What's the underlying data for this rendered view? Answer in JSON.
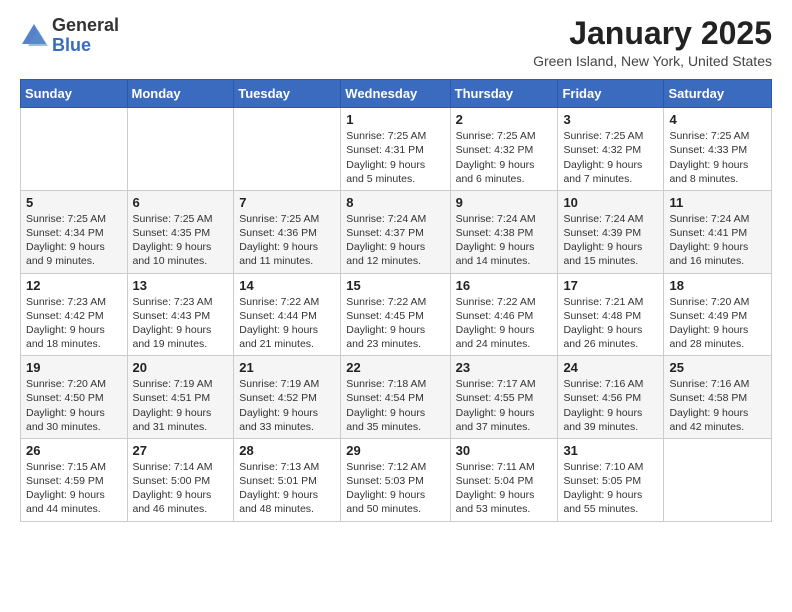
{
  "header": {
    "logo_general": "General",
    "logo_blue": "Blue",
    "month_title": "January 2025",
    "location": "Green Island, New York, United States"
  },
  "weekdays": [
    "Sunday",
    "Monday",
    "Tuesday",
    "Wednesday",
    "Thursday",
    "Friday",
    "Saturday"
  ],
  "weeks": [
    [
      {
        "day": "",
        "lines": []
      },
      {
        "day": "",
        "lines": []
      },
      {
        "day": "",
        "lines": []
      },
      {
        "day": "1",
        "lines": [
          "Sunrise: 7:25 AM",
          "Sunset: 4:31 PM",
          "Daylight: 9 hours",
          "and 5 minutes."
        ]
      },
      {
        "day": "2",
        "lines": [
          "Sunrise: 7:25 AM",
          "Sunset: 4:32 PM",
          "Daylight: 9 hours",
          "and 6 minutes."
        ]
      },
      {
        "day": "3",
        "lines": [
          "Sunrise: 7:25 AM",
          "Sunset: 4:32 PM",
          "Daylight: 9 hours",
          "and 7 minutes."
        ]
      },
      {
        "day": "4",
        "lines": [
          "Sunrise: 7:25 AM",
          "Sunset: 4:33 PM",
          "Daylight: 9 hours",
          "and 8 minutes."
        ]
      }
    ],
    [
      {
        "day": "5",
        "lines": [
          "Sunrise: 7:25 AM",
          "Sunset: 4:34 PM",
          "Daylight: 9 hours",
          "and 9 minutes."
        ]
      },
      {
        "day": "6",
        "lines": [
          "Sunrise: 7:25 AM",
          "Sunset: 4:35 PM",
          "Daylight: 9 hours",
          "and 10 minutes."
        ]
      },
      {
        "day": "7",
        "lines": [
          "Sunrise: 7:25 AM",
          "Sunset: 4:36 PM",
          "Daylight: 9 hours",
          "and 11 minutes."
        ]
      },
      {
        "day": "8",
        "lines": [
          "Sunrise: 7:24 AM",
          "Sunset: 4:37 PM",
          "Daylight: 9 hours",
          "and 12 minutes."
        ]
      },
      {
        "day": "9",
        "lines": [
          "Sunrise: 7:24 AM",
          "Sunset: 4:38 PM",
          "Daylight: 9 hours",
          "and 14 minutes."
        ]
      },
      {
        "day": "10",
        "lines": [
          "Sunrise: 7:24 AM",
          "Sunset: 4:39 PM",
          "Daylight: 9 hours",
          "and 15 minutes."
        ]
      },
      {
        "day": "11",
        "lines": [
          "Sunrise: 7:24 AM",
          "Sunset: 4:41 PM",
          "Daylight: 9 hours",
          "and 16 minutes."
        ]
      }
    ],
    [
      {
        "day": "12",
        "lines": [
          "Sunrise: 7:23 AM",
          "Sunset: 4:42 PM",
          "Daylight: 9 hours",
          "and 18 minutes."
        ]
      },
      {
        "day": "13",
        "lines": [
          "Sunrise: 7:23 AM",
          "Sunset: 4:43 PM",
          "Daylight: 9 hours",
          "and 19 minutes."
        ]
      },
      {
        "day": "14",
        "lines": [
          "Sunrise: 7:22 AM",
          "Sunset: 4:44 PM",
          "Daylight: 9 hours",
          "and 21 minutes."
        ]
      },
      {
        "day": "15",
        "lines": [
          "Sunrise: 7:22 AM",
          "Sunset: 4:45 PM",
          "Daylight: 9 hours",
          "and 23 minutes."
        ]
      },
      {
        "day": "16",
        "lines": [
          "Sunrise: 7:22 AM",
          "Sunset: 4:46 PM",
          "Daylight: 9 hours",
          "and 24 minutes."
        ]
      },
      {
        "day": "17",
        "lines": [
          "Sunrise: 7:21 AM",
          "Sunset: 4:48 PM",
          "Daylight: 9 hours",
          "and 26 minutes."
        ]
      },
      {
        "day": "18",
        "lines": [
          "Sunrise: 7:20 AM",
          "Sunset: 4:49 PM",
          "Daylight: 9 hours",
          "and 28 minutes."
        ]
      }
    ],
    [
      {
        "day": "19",
        "lines": [
          "Sunrise: 7:20 AM",
          "Sunset: 4:50 PM",
          "Daylight: 9 hours",
          "and 30 minutes."
        ]
      },
      {
        "day": "20",
        "lines": [
          "Sunrise: 7:19 AM",
          "Sunset: 4:51 PM",
          "Daylight: 9 hours",
          "and 31 minutes."
        ]
      },
      {
        "day": "21",
        "lines": [
          "Sunrise: 7:19 AM",
          "Sunset: 4:52 PM",
          "Daylight: 9 hours",
          "and 33 minutes."
        ]
      },
      {
        "day": "22",
        "lines": [
          "Sunrise: 7:18 AM",
          "Sunset: 4:54 PM",
          "Daylight: 9 hours",
          "and 35 minutes."
        ]
      },
      {
        "day": "23",
        "lines": [
          "Sunrise: 7:17 AM",
          "Sunset: 4:55 PM",
          "Daylight: 9 hours",
          "and 37 minutes."
        ]
      },
      {
        "day": "24",
        "lines": [
          "Sunrise: 7:16 AM",
          "Sunset: 4:56 PM",
          "Daylight: 9 hours",
          "and 39 minutes."
        ]
      },
      {
        "day": "25",
        "lines": [
          "Sunrise: 7:16 AM",
          "Sunset: 4:58 PM",
          "Daylight: 9 hours",
          "and 42 minutes."
        ]
      }
    ],
    [
      {
        "day": "26",
        "lines": [
          "Sunrise: 7:15 AM",
          "Sunset: 4:59 PM",
          "Daylight: 9 hours",
          "and 44 minutes."
        ]
      },
      {
        "day": "27",
        "lines": [
          "Sunrise: 7:14 AM",
          "Sunset: 5:00 PM",
          "Daylight: 9 hours",
          "and 46 minutes."
        ]
      },
      {
        "day": "28",
        "lines": [
          "Sunrise: 7:13 AM",
          "Sunset: 5:01 PM",
          "Daylight: 9 hours",
          "and 48 minutes."
        ]
      },
      {
        "day": "29",
        "lines": [
          "Sunrise: 7:12 AM",
          "Sunset: 5:03 PM",
          "Daylight: 9 hours",
          "and 50 minutes."
        ]
      },
      {
        "day": "30",
        "lines": [
          "Sunrise: 7:11 AM",
          "Sunset: 5:04 PM",
          "Daylight: 9 hours",
          "and 53 minutes."
        ]
      },
      {
        "day": "31",
        "lines": [
          "Sunrise: 7:10 AM",
          "Sunset: 5:05 PM",
          "Daylight: 9 hours",
          "and 55 minutes."
        ]
      },
      {
        "day": "",
        "lines": []
      }
    ]
  ]
}
